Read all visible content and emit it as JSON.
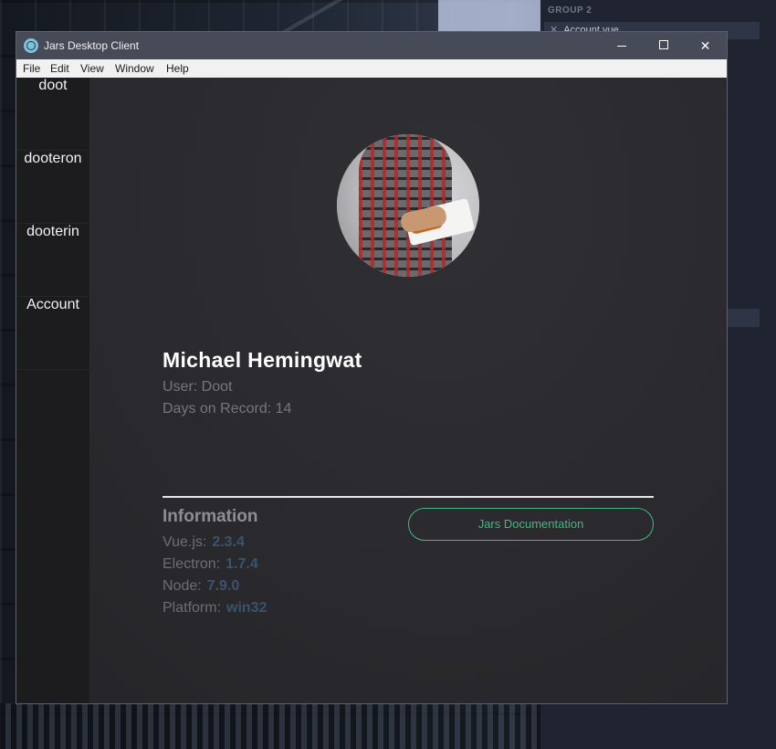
{
  "window": {
    "title": "Jars Desktop Client",
    "controls": {
      "minimize": "minimize",
      "maximize": "maximize",
      "close": "✕"
    }
  },
  "menubar": [
    "File",
    "Edit",
    "View",
    "Window",
    "Help"
  ],
  "sidebar": {
    "items": [
      {
        "label": "doot"
      },
      {
        "label": "dooteron"
      },
      {
        "label": "dooterin"
      },
      {
        "label": "Account"
      }
    ]
  },
  "profile": {
    "name": "Michael Hemingwat",
    "user_line": "User: Doot",
    "days_line": "Days on Record: 14"
  },
  "information": {
    "title": "Information",
    "rows": [
      {
        "label": "Vue.js:",
        "value": "2.3.4"
      },
      {
        "label": "Electron:",
        "value": "1.7.4"
      },
      {
        "label": "Node:",
        "value": "7.9.0"
      },
      {
        "label": "Platform:",
        "value": "win32"
      }
    ]
  },
  "doc_button": {
    "label": "Jars Documentation",
    "color": "#41b883"
  },
  "background_editor": {
    "group_label": "GROUP 2",
    "open_file": "Account.vue"
  },
  "colors": {
    "accent": "#41b883",
    "value_text": "#3a536e",
    "titlebar": "#464b57"
  }
}
